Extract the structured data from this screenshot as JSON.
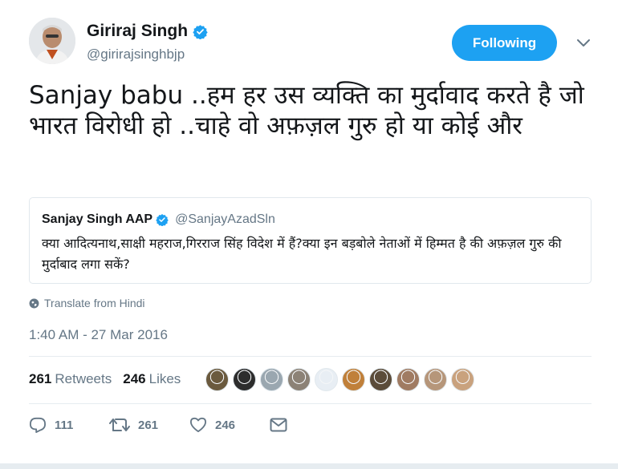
{
  "author": {
    "name": "Giriraj Singh",
    "handle": "@girirajsinghbjp"
  },
  "follow_button": {
    "label": "Following"
  },
  "tweet": {
    "text": "Sanjay babu ..हम हर उस व्यक्ति का मुर्दावाद करते है जो भारत विरोधी हो ..चाहे वो अफ़ज़ल गुरु हो या कोई और"
  },
  "quoted_tweet": {
    "name": "Sanjay Singh AAP",
    "handle": "@SanjayAzadSln",
    "text": "क्या आदित्यनाथ,साक्षी महराज,गिरराज सिंह विदेश में हैं?क्या इन बड़बोले नेताओं में हिम्मत है की अफ़ज़ल गुरु की मुर्दाबाद लगा सकें?"
  },
  "translate": {
    "label": "Translate from Hindi",
    "icon": "globe-icon"
  },
  "timestamp": "1:40 AM - 27 Mar 2016",
  "stats": {
    "retweets_count": "261",
    "retweets_label": "Retweets",
    "likes_count": "246",
    "likes_label": "Likes"
  },
  "likers": [
    {
      "color": "#6b5a3e"
    },
    {
      "color": "#2d2d2d"
    },
    {
      "color": "#9aa7b0"
    },
    {
      "color": "#8c8276"
    },
    {
      "color": "#e8eef4"
    },
    {
      "color": "#c0803a"
    },
    {
      "color": "#5b4c3a"
    },
    {
      "color": "#a07b62"
    },
    {
      "color": "#b6967a"
    },
    {
      "color": "#c9a27e"
    }
  ],
  "actions": {
    "reply_count": "111",
    "retweet_count": "261",
    "like_count": "246"
  },
  "colors": {
    "accent": "#1da1f2",
    "secondary_text": "#657786",
    "primary_text": "#14171a"
  }
}
